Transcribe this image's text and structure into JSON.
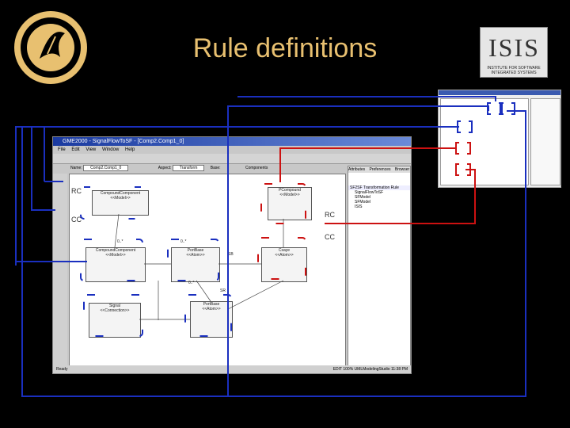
{
  "slide": {
    "title": "Rule definitions"
  },
  "app": {
    "window_title": "GME2000 - SignalFlowToSF - [Comp2.Comp1_0]",
    "menu": [
      "File",
      "Edit",
      "View",
      "Window",
      "Help"
    ],
    "name_label": "Name:",
    "name_value": "Comp2.Comp1_0",
    "aspect_label": "Aspect:",
    "aspect_value": "Transform",
    "base_label": "Base:",
    "components_label": "Components",
    "status_left": "Ready",
    "status_right": "EDIT  100%  UMLModelingStudio  11:38 PM"
  },
  "panel": {
    "tabs": [
      "Attributes",
      "Preferences",
      "Browser"
    ],
    "tree_root": "SF2SF Transformation Rule",
    "tree_items": [
      "SignalFlowToSF",
      "SFModel",
      "SFModel",
      "ISIS"
    ]
  },
  "diagram": {
    "boxes": [
      {
        "name": "CompoundComponent",
        "stereo": "<<Model>>"
      },
      {
        "name": "PCompound",
        "stereo": "<<Model>>"
      },
      {
        "name": "CompoundComponent",
        "stereo": "<<Model>>"
      },
      {
        "name": "PortBase",
        "stereo": "<<Atom>>"
      },
      {
        "name": "Csaye",
        "stereo": "<<Atom>>"
      },
      {
        "name": "Signal",
        "stereo": "<<Connection>>"
      },
      {
        "name": "PortBase",
        "stereo": "<<Atom>>"
      }
    ],
    "labels": {
      "left_top": "RC",
      "left_bottom": "CC",
      "right_top": "RC",
      "right_bottom": "CC",
      "sb": "SB",
      "sr": "SR",
      "mult_a": "0..*",
      "mult_b": "0..*",
      "mult_c": "0..*"
    }
  },
  "colors": {
    "background": "#000000",
    "title": "#e8c070",
    "connector_blue": "#1a2fbf",
    "connector_red": "#cc1111"
  }
}
